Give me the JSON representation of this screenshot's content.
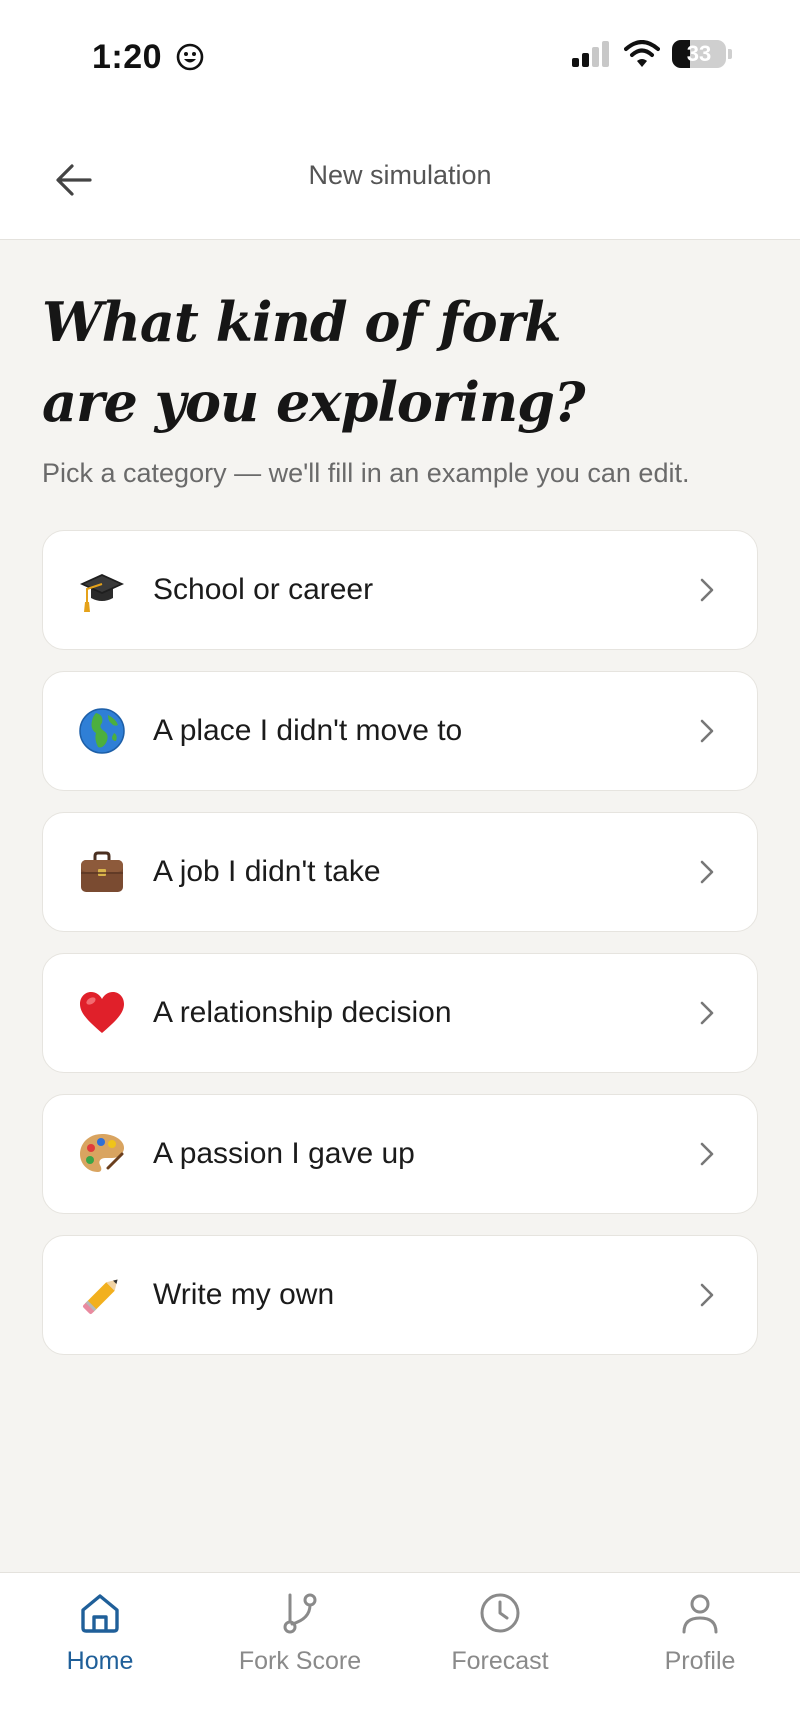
{
  "status_bar": {
    "time": "1:20",
    "battery": "33"
  },
  "nav": {
    "title": "New simulation"
  },
  "heading": {
    "line1": "What kind of fork",
    "line2": "are you exploring?"
  },
  "subtitle": "Pick a category — we'll fill in an example you can edit.",
  "categories": [
    {
      "label": "School or career",
      "icon": "graduation-cap-icon"
    },
    {
      "label": "A place I didn't move to",
      "icon": "globe-icon"
    },
    {
      "label": "A job I didn't take",
      "icon": "briefcase-icon"
    },
    {
      "label": "A relationship decision",
      "icon": "heart-icon"
    },
    {
      "label": "A passion I gave up",
      "icon": "palette-icon"
    },
    {
      "label": "Write my own",
      "icon": "pencil-icon"
    }
  ],
  "tabs": [
    {
      "label": "Home",
      "icon": "home-icon",
      "active": true
    },
    {
      "label": "Fork Score",
      "icon": "fork-icon",
      "active": false
    },
    {
      "label": "Forecast",
      "icon": "clock-icon",
      "active": false
    },
    {
      "label": "Profile",
      "icon": "person-icon",
      "active": false
    }
  ],
  "colors": {
    "accent": "#1f5f99",
    "background": "#f5f4f1",
    "card": "#ffffff",
    "muted": "#8a8a8a"
  }
}
